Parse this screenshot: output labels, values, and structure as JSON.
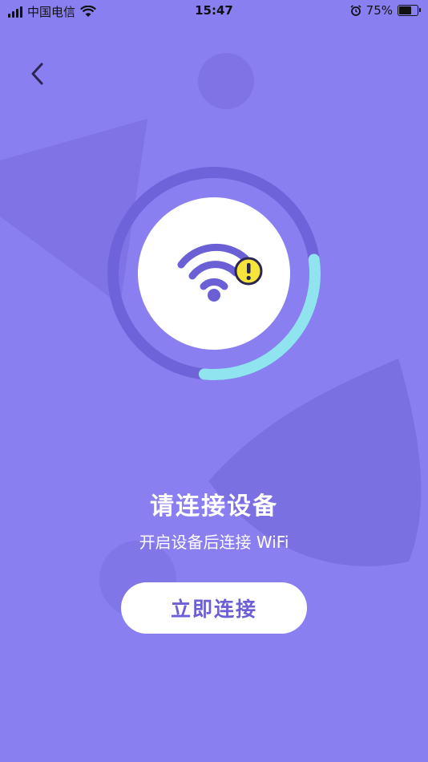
{
  "status_bar": {
    "carrier": "中国电信",
    "time": "15:47",
    "battery_percent": "75%",
    "battery_level": 0.75,
    "icons": [
      "signal-icon",
      "wifi-icon",
      "alarm-icon",
      "battery-icon"
    ]
  },
  "nav": {
    "back_icon": "chevron-left-icon"
  },
  "connection": {
    "progress": 0.25,
    "status_icon": "wifi-warning-icon",
    "ring_color": "#6e63d9",
    "progress_color": "#8fe4f0",
    "warning_color": "#f7e43a"
  },
  "content": {
    "title": "请连接设备",
    "subtitle": "开启设备后连接 WiFi"
  },
  "actions": {
    "connect_label": "立即连接"
  },
  "colors": {
    "background": "#8a7ff0",
    "accent": "#6b5fd6"
  }
}
